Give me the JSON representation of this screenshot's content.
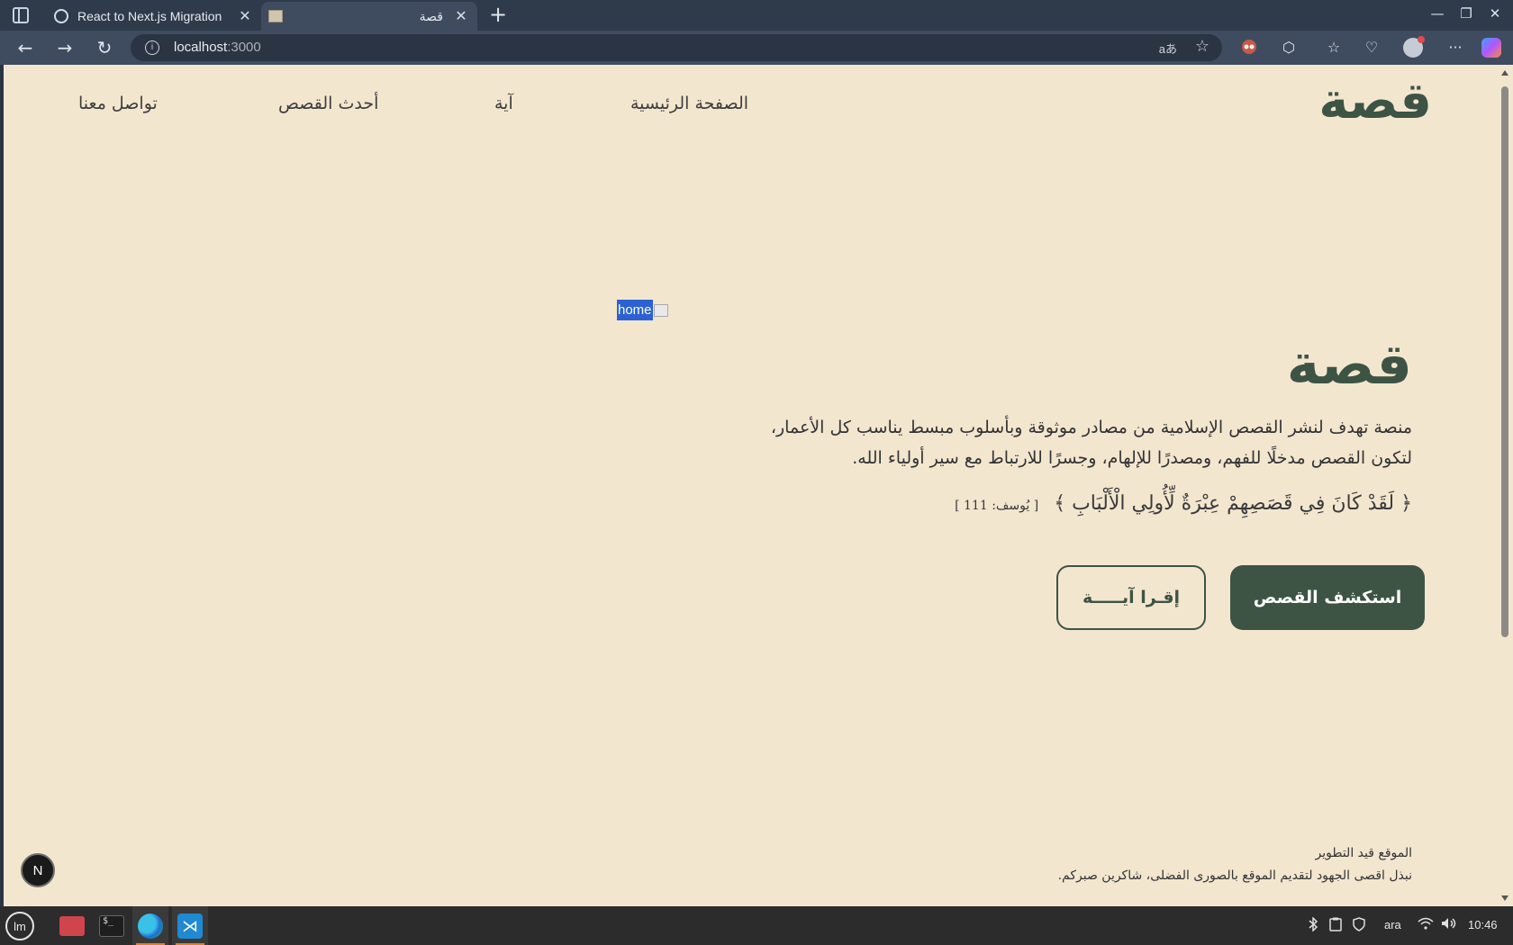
{
  "browser": {
    "tabs": [
      {
        "title": "React to Next.js Migration",
        "close": "✕"
      },
      {
        "title": "قصة",
        "close": "✕"
      }
    ],
    "new_tab": "+",
    "window": {
      "minimize": "—",
      "restore": "❐",
      "close": "✕"
    },
    "url": {
      "host": "localhost",
      "port": ":3000"
    },
    "nav": {
      "back": "←",
      "forward": "→",
      "reload": "↻"
    },
    "url_icons": {
      "translate": "aあ",
      "favorite": "☆"
    },
    "toolbar_icons": {
      "extensions": "⬡",
      "favorites": "☆",
      "performance": "♡",
      "more": "···"
    }
  },
  "site": {
    "logo": "قصة",
    "nav": [
      "الصفحة الرئيسية",
      "آية",
      "أحدث القصص",
      "تواصل معنا"
    ],
    "hero_image_alt": "home",
    "hero": {
      "title": "قصة",
      "description": "منصة تهدف لنشر القصص الإسلامية من مصادر موثوقة وبأسلوب مبسط يناسب كل الأعمار، لتكون القصص مدخلًا للفهم، ومصدرًا للإلهام، وجسرًا للارتباط مع سير أولياء الله.",
      "verse": "﴿ لَقَدْ كَانَ فِي قَصَصِهِمْ عِبْرَةٌ لِّأُولِي الْأَلْبَابِ ﴾",
      "verse_ref": "[ يُوسف: 111 ]",
      "primary_button": "استكشف القصص",
      "secondary_button": "إقـرا آيـــــة"
    },
    "footer": {
      "line1": "الموقع قيد التطوير",
      "line2": "نبذل اقصى الجهود لتقديم الموقع بالصورى الفضلى، شاكرين صبركم."
    },
    "dev_badge": "N"
  },
  "taskbar": {
    "menu": "lm",
    "terminal_label": "$_",
    "vscode_label": "⋊",
    "keyboard_layout": "ara",
    "clock": "10:46"
  },
  "colors": {
    "page_bg": "#f3e6cf",
    "brand_green": "#3d5445",
    "selection_blue": "#2b61d4"
  }
}
